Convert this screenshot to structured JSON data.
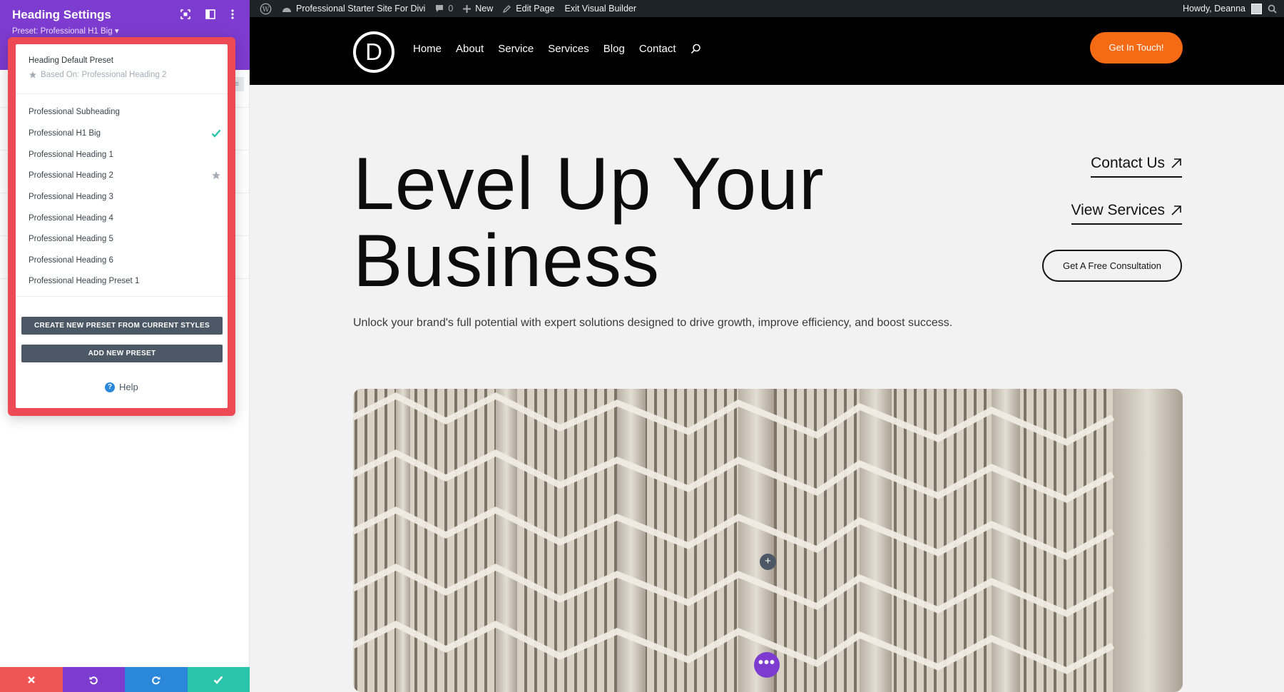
{
  "admin_bar": {
    "site_name": "Professional Starter Site For Divi",
    "comments_count": "0",
    "new_label": "New",
    "edit_page_label": "Edit Page",
    "exit_builder_label": "Exit Visual Builder",
    "greeting": "Howdy, Deanna",
    "background_color": "#1d2327"
  },
  "panel": {
    "title": "Heading Settings",
    "preset_line": "Preset: Professional H1 Big ▾",
    "header_color": "#7e3bd0",
    "dropdown": {
      "default_preset": "Heading Default Preset",
      "based_on": "Based On: Professional Heading 2",
      "presets": [
        {
          "label": "Professional Subheading",
          "marker": ""
        },
        {
          "label": "Professional H1 Big",
          "marker": "check"
        },
        {
          "label": "Professional Heading 1",
          "marker": ""
        },
        {
          "label": "Professional Heading 2",
          "marker": "star"
        },
        {
          "label": "Professional Heading 3",
          "marker": ""
        },
        {
          "label": "Professional Heading 4",
          "marker": ""
        },
        {
          "label": "Professional Heading 5",
          "marker": ""
        },
        {
          "label": "Professional Heading 6",
          "marker": ""
        },
        {
          "label": "Professional Heading Preset 1",
          "marker": ""
        }
      ],
      "create_button": "CREATE NEW PRESET FROM CURRENT STYLES",
      "add_button": "ADD NEW PRESET",
      "help_label": "Help",
      "highlight_color": "#ed4a56"
    },
    "bottom_bar_colors": [
      "#ef5555",
      "#7e3bd0",
      "#2b87da",
      "#29c4a9"
    ]
  },
  "site": {
    "nav": [
      "Home",
      "About",
      "Service",
      "Services",
      "Blog",
      "Contact"
    ],
    "logo_letter": "D",
    "cta_label": "Get In Touch!",
    "cta_color": "#f56a15",
    "hero_line1": "Level Up Your",
    "hero_line2": "Business",
    "intro": "Unlock your brand's full potential with expert solutions designed to drive growth, improve efficiency, and boost success.",
    "contact_link": "Contact Us",
    "services_link": "View Services",
    "consult_button": "Get A Free Consultation"
  }
}
